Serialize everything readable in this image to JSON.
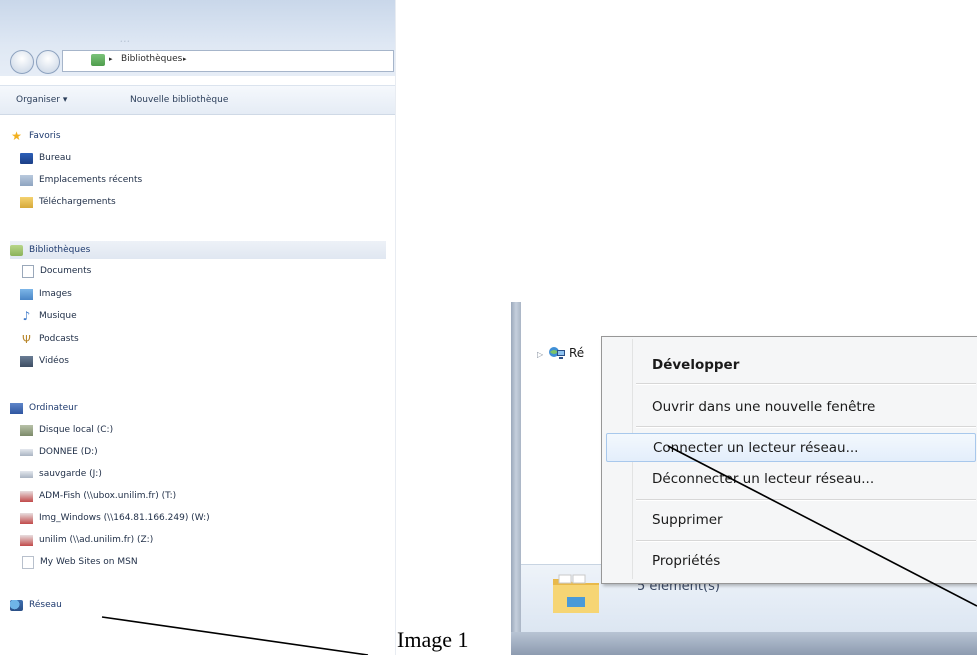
{
  "explorer": {
    "title_text": "...",
    "address": {
      "arrow1": "▸",
      "location": "Bibliothèques",
      "arrow2": "▸"
    },
    "toolbar": {
      "organize_label": "Organiser ▾",
      "new_library_label": "Nouvelle bibliothèque"
    },
    "nav": {
      "favorites": {
        "label": "Favoris",
        "items": [
          "Bureau",
          "Emplacements récents",
          "Téléchargements"
        ]
      },
      "libraries": {
        "label": "Bibliothèques",
        "items": [
          "Documents",
          "Images",
          "Musique",
          "Podcasts",
          "Vidéos"
        ]
      },
      "computer": {
        "label": "Ordinateur",
        "items": [
          "Disque local (C:)",
          "DONNEE (D:)",
          "sauvgarde (J:)",
          "ADM-Fish (\\\\ubox.unilim.fr) (T:)",
          "Img_Windows (\\\\164.81.166.249) (W:)",
          "unilim (\\\\ad.unilim.fr) (Z:)",
          "My Web Sites on MSN"
        ]
      },
      "network": {
        "label": "Réseau"
      }
    }
  },
  "detail": {
    "tree_arrow": "▷",
    "tree_network_label": "Ré",
    "status_count": "5 élément(s)"
  },
  "context_menu": {
    "items": [
      "Développer",
      "Ouvrir dans une nouvelle fenêtre",
      "Connecter un lecteur réseau...",
      "Déconnecter un lecteur réseau...",
      "Supprimer",
      "Propriétés"
    ]
  },
  "caption": "Image 1",
  "colors": {
    "accent": "#1e3a6e",
    "menu_highlight": "#e3eefb",
    "menu_highlight_border": "#a8c8ec"
  },
  "icons": [
    "star-icon",
    "desktop-icon",
    "recent-places-icon",
    "downloads-icon",
    "libraries-icon",
    "documents-icon",
    "images-icon",
    "music-icon",
    "podcasts-icon",
    "videos-icon",
    "computer-icon",
    "local-disk-icon",
    "drive-icon",
    "network-drive-icon",
    "web-page-icon",
    "network-icon",
    "folder-icon"
  ]
}
